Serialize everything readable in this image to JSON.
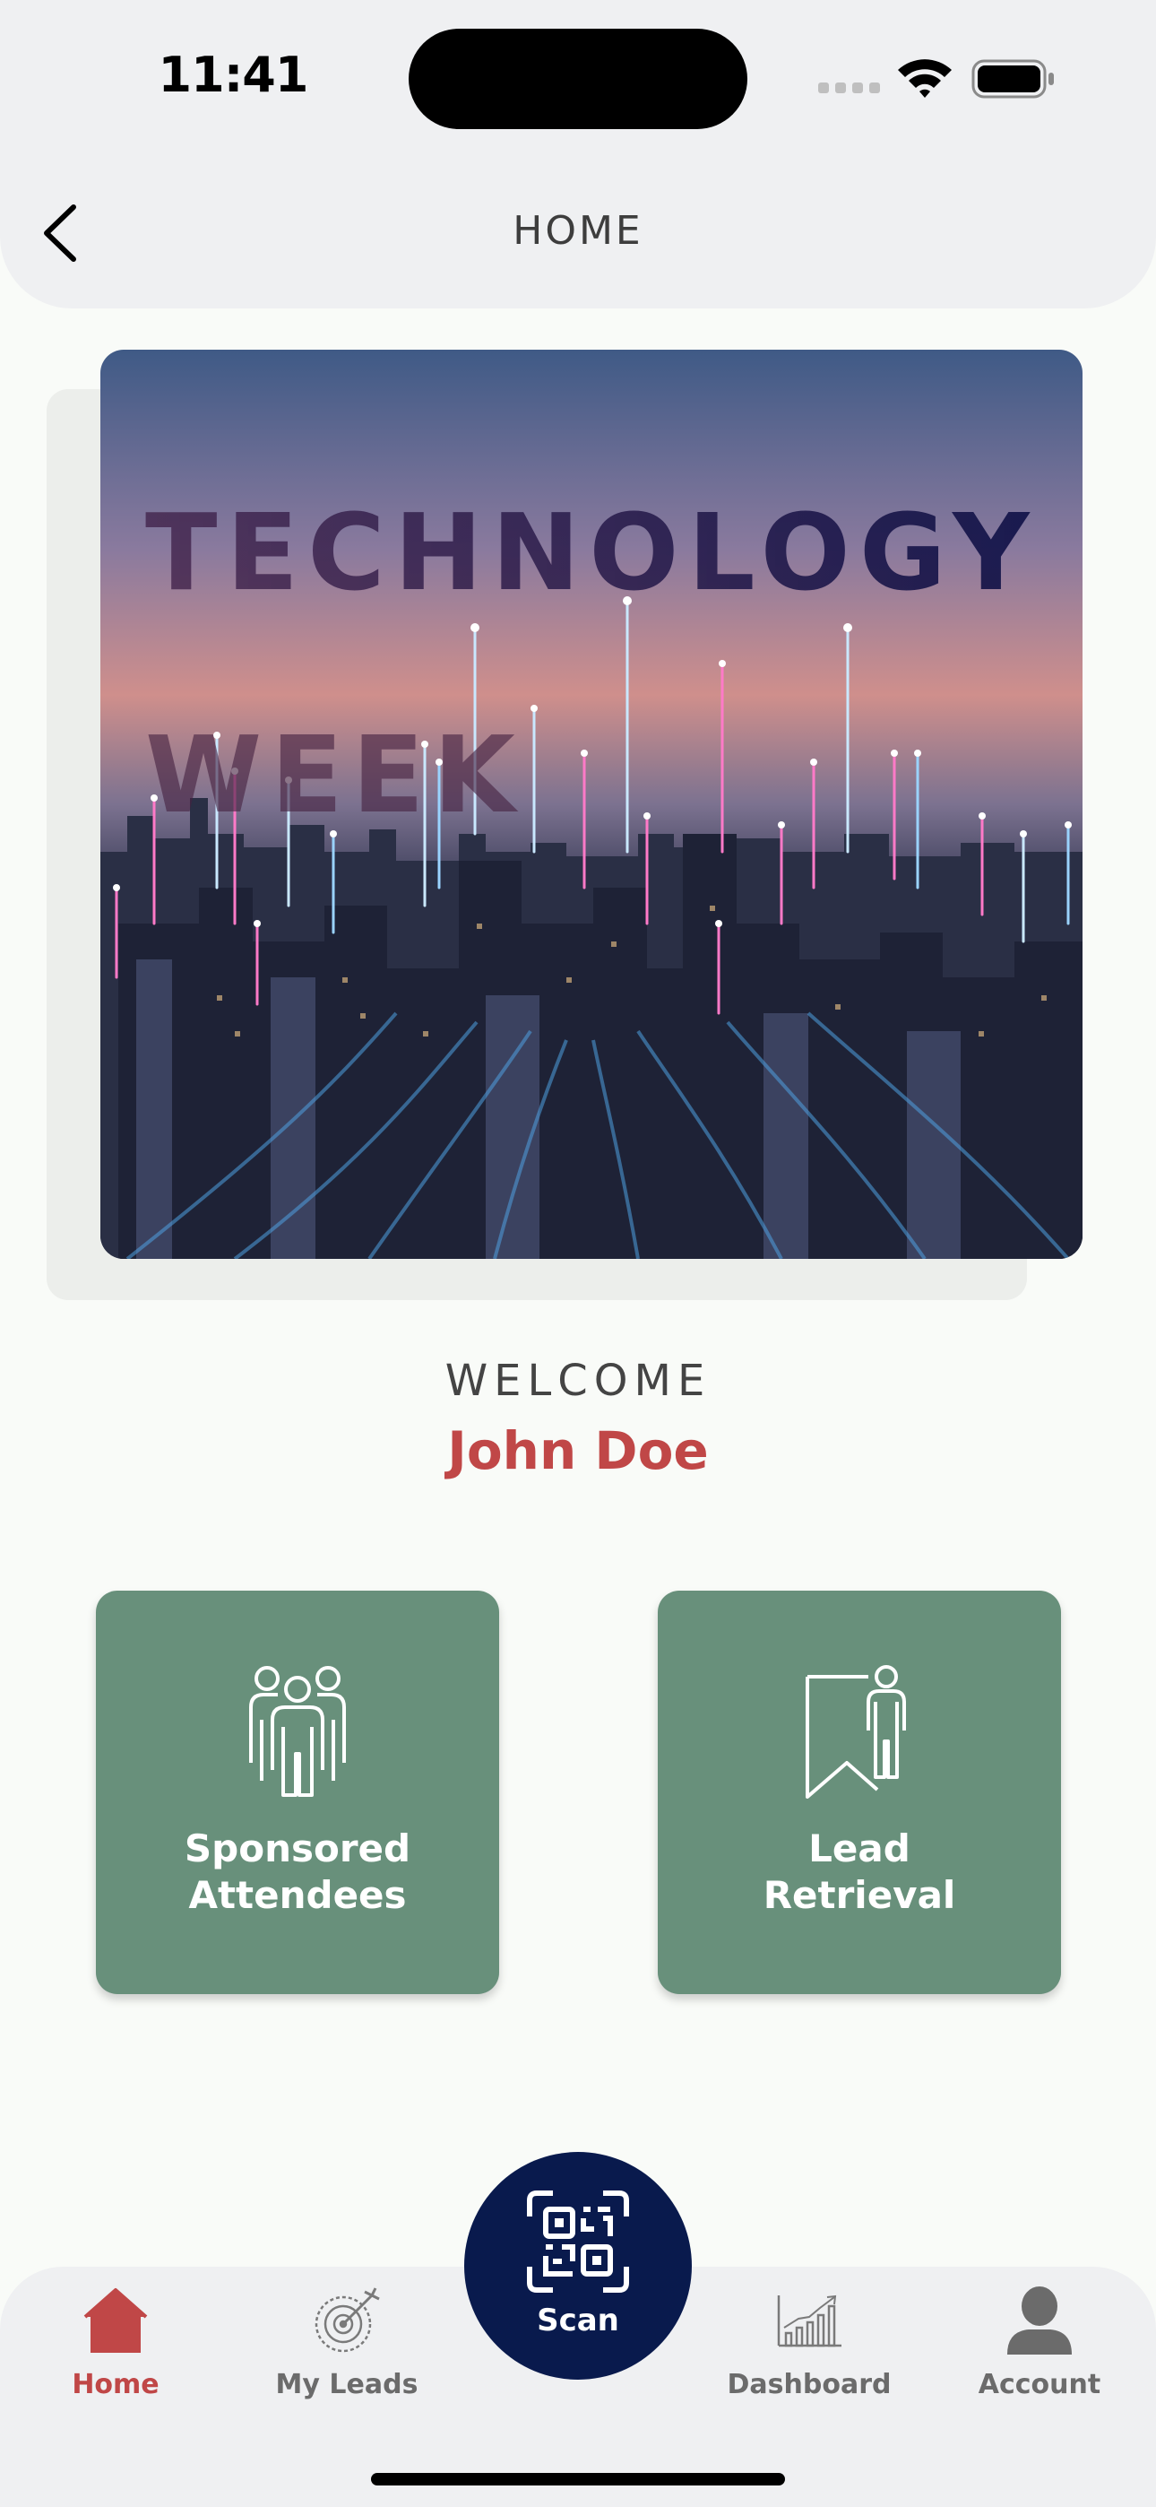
{
  "status_bar": {
    "time": "11:41"
  },
  "header": {
    "title": "HOME",
    "back_icon": "chevron-left-icon"
  },
  "hero": {
    "title_line1": "TECHNOLOGY",
    "title_line2": "WEEK"
  },
  "welcome": {
    "label": "WELCOME",
    "user_name": "John Doe",
    "name_color": "#c04747"
  },
  "actions": [
    {
      "label_line1": "Sponsored",
      "label_line2": "Attendees",
      "icon": "people-group-icon"
    },
    {
      "label_line1": "Lead",
      "label_line2": "Retrieval",
      "icon": "bookmark-person-icon"
    }
  ],
  "tab_bar": {
    "tabs": [
      {
        "label": "Home",
        "icon": "home-icon",
        "active": true
      },
      {
        "label": "My Leads",
        "icon": "target-icon",
        "active": false
      },
      {
        "label": "Scan",
        "icon": "qr-code-icon",
        "active": false
      },
      {
        "label": "Dashboard",
        "icon": "bar-chart-icon",
        "active": false
      },
      {
        "label": "Account",
        "icon": "user-icon",
        "active": false
      }
    ]
  },
  "colors": {
    "accent": "#c04747",
    "card": "#68907b",
    "scan_button": "#091a4d",
    "background": "#f9fbf8",
    "header": "#eff0f2"
  }
}
